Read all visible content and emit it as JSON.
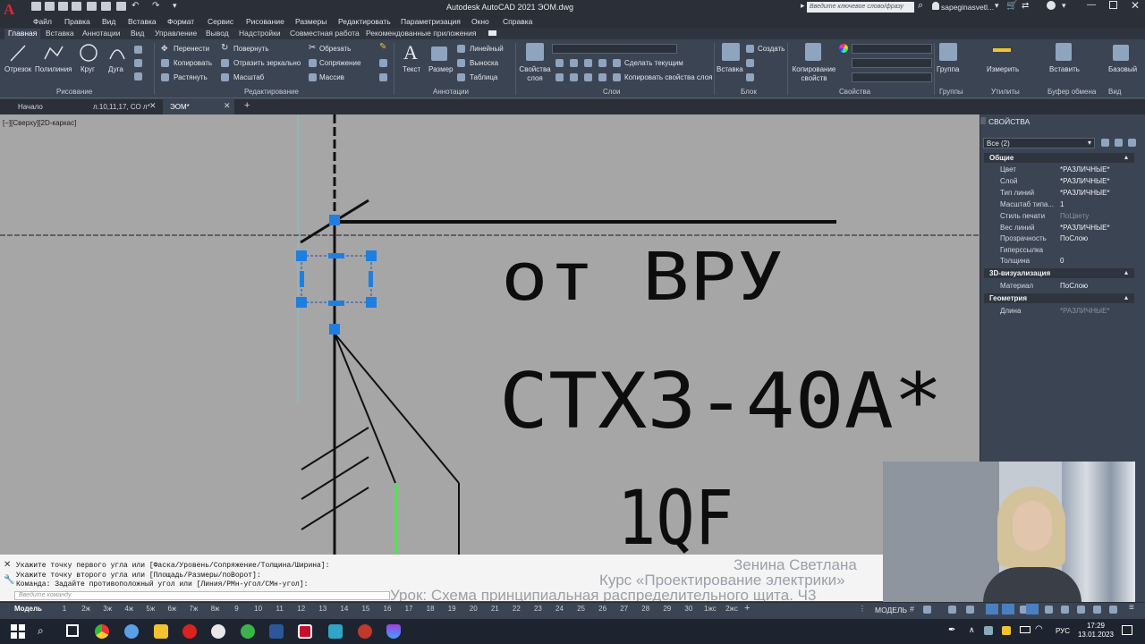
{
  "title_bar": {
    "app_title": "Autodesk AutoCAD 2021   ЭОМ.dwg",
    "search_placeholder": "Введите ключевое слово/фразу",
    "user": "sapeginasvetl..."
  },
  "menu": [
    "Файл",
    "Правка",
    "Вид",
    "Вставка",
    "Формат",
    "Сервис",
    "Рисование",
    "Размеры",
    "Редактировать",
    "Параметризация",
    "Окно",
    "Справка"
  ],
  "ribbon_tabs": [
    "Главная",
    "Вставка",
    "Аннотации",
    "Вид",
    "Управление",
    "Вывод",
    "Надстройки",
    "Совместная работа",
    "Рекомендованные приложения"
  ],
  "ribbon": {
    "draw": {
      "line": "Отрезок",
      "polyline": "Полилиния",
      "circle": "Круг",
      "arc": "Дуга",
      "panel": "Рисование"
    },
    "modify": {
      "move": "Перенести",
      "rotate": "Повернуть",
      "trim": "Обрезать",
      "copy": "Копировать",
      "mirror": "Отразить зеркально",
      "fillet": "Сопряжение",
      "stretch": "Растянуть",
      "scale": "Масштаб",
      "array": "Массив",
      "panel": "Редактирование"
    },
    "annotation": {
      "text": "Текст",
      "dimension": "Размер",
      "linear": "Линейный",
      "leader": "Выноска",
      "table": "Таблица",
      "panel": "Аннотации"
    },
    "layers": {
      "layer_props": "Свойства слоя",
      "make_current": "Сделать текущим",
      "match_layer": "Копировать свойства слоя",
      "panel": "Слои"
    },
    "block": {
      "insert": "Вставка",
      "create": "Создать",
      "panel": "Блок"
    },
    "properties": {
      "match": "Копирование свойств",
      "panel": "Свойства"
    },
    "groups": {
      "group": "Группа",
      "panel": "Группы"
    },
    "utilities": {
      "measure": "Измерить",
      "panel": "Утилиты"
    },
    "clipboard": {
      "paste": "Вставить",
      "panel": "Буфер обмена"
    },
    "view": {
      "base": "Базовый",
      "panel": "Вид"
    }
  },
  "doc_tabs": [
    "Начало",
    "л.10,11,17, СО л*",
    "ЭОМ*"
  ],
  "viewport_label": "[−][Сверху][2D-каркас]",
  "drawing_text": {
    "line1": "от ВРУ",
    "line2": "СТХ3-40А*",
    "line3": "1QF"
  },
  "properties_palette": {
    "title": "СВОЙСТВА",
    "selection": "Все (2)",
    "sections": {
      "general": "Общие",
      "viz3d": "3D-визуализация",
      "geometry": "Геометрия"
    },
    "general": [
      {
        "label": "Цвет",
        "value": "*РАЗЛИЧНЫЕ*"
      },
      {
        "label": "Слой",
        "value": "*РАЗЛИЧНЫЕ*"
      },
      {
        "label": "Тип линий",
        "value": "*РАЗЛИЧНЫЕ*"
      },
      {
        "label": "Масштаб типа...",
        "value": "1"
      },
      {
        "label": "Стиль печати",
        "value": "ПоЦвету"
      },
      {
        "label": "Вес линий",
        "value": "*РАЗЛИЧНЫЕ*"
      },
      {
        "label": "Прозрачность",
        "value": "ПоСлою"
      },
      {
        "label": "Гиперссылка",
        "value": ""
      },
      {
        "label": "Толщина",
        "value": "0"
      }
    ],
    "viz3d": [
      {
        "label": "Материал",
        "value": "ПоСлою"
      }
    ],
    "geometry": [
      {
        "label": "Длина",
        "value": "*РАЗЛИЧНЫЕ*"
      }
    ]
  },
  "command_history": [
    "Укажите точку первого угла или [Фаска/Уровень/Сопряжение/Толщина/Ширина]:",
    "Укажите точку второго угла или [Площадь/Размеры/поВорот]:",
    "Команда: Задайте противоположный угол или [Линия/РМн-угол/СМн-угол]:"
  ],
  "command_input_placeholder": "Введите команду",
  "watermark": {
    "author": "Зенина Светлана",
    "course": "Курс «Проектирование электрики»",
    "lesson": "Урок: Схема принципиальная распределительного щита. Ч3"
  },
  "status_bar": {
    "model_tab": "Модель",
    "layouts": [
      "1",
      "2ж",
      "3ж",
      "4ж",
      "5ж",
      "6ж",
      "7ж",
      "8ж",
      "9",
      "10",
      "11",
      "12",
      "13",
      "14",
      "15",
      "16",
      "17",
      "18",
      "19",
      "20",
      "21",
      "22",
      "23",
      "24",
      "25",
      "26",
      "27",
      "28",
      "29",
      "30",
      "1жс",
      "2жс"
    ],
    "model_label": "МОДЕЛЬ"
  },
  "taskbar": {
    "time": "17:29",
    "date": "13.01.2023",
    "lang": "РУС"
  },
  "colors": {
    "canvas_bg": "#a6a6a6",
    "grip": "#1e7fe0",
    "accent_green": "#49e84a",
    "ribbon_bg": "#3b4453"
  }
}
